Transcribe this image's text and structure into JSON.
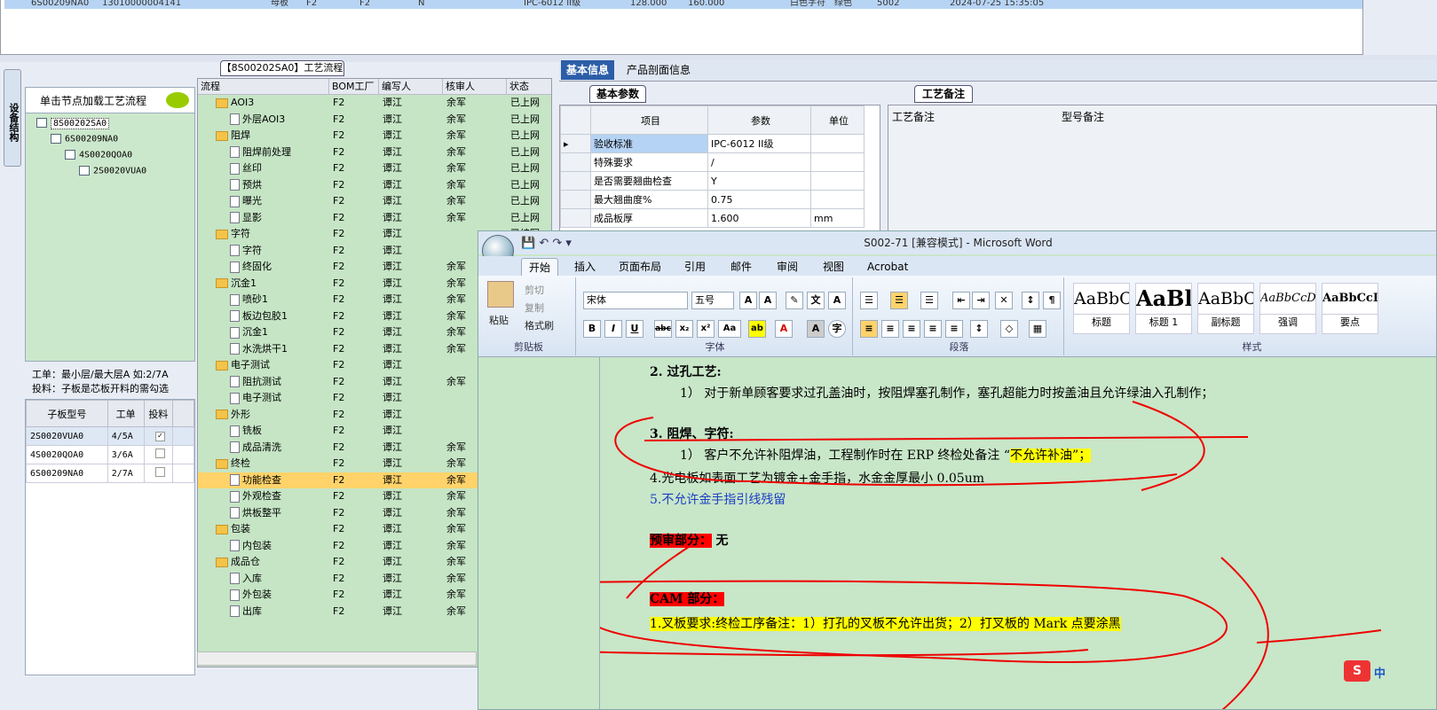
{
  "top_row": {
    "c1": "6S00209NA0",
    "c2": "13010000004141",
    "c3": "母板",
    "c4": "F2",
    "c5": "F2",
    "c6": "N",
    "c7": "IPC-6012 II级",
    "c8": "128.000",
    "c9": "160.000",
    "c10": "白色字符",
    "c11": "绿色",
    "c12": "5002",
    "c13": "2024-07-25 15:35:05"
  },
  "side_tab": "设备结构",
  "flow_title": "【8S00202SA0】工艺流程",
  "tree": {
    "hint": "单击节点加载工艺流程",
    "nodes": [
      "8S00202SA0",
      "6S00209NA0",
      "4S0020QOA0",
      "2S0020VUA0"
    ]
  },
  "order_info": {
    "line1": "工单：最小层/最大层A 如:2/7A",
    "line2": "投料：子板是芯板开料的需勾选"
  },
  "sub_grid": {
    "headers": [
      "子板型号",
      "工单",
      "投料"
    ],
    "rows": [
      {
        "model": "2S0020VUA0",
        "order": "4/5A",
        "checked": "✓"
      },
      {
        "model": "4S0020QOA0",
        "order": "3/6A",
        "checked": ""
      },
      {
        "model": "6S00209NA0",
        "order": "2/7A",
        "checked": ""
      }
    ]
  },
  "flow_grid": {
    "headers": [
      "流程",
      "BOM工厂",
      "编写人",
      "核审人",
      "状态"
    ],
    "rows": [
      {
        "name": "AOI3",
        "folder": true,
        "f": "F2",
        "w": "谭江",
        "r": "余军",
        "s": "已上网"
      },
      {
        "name": "外层AOI3",
        "folder": false,
        "f": "F2",
        "w": "谭江",
        "r": "余军",
        "s": "已上网"
      },
      {
        "name": "阻焊",
        "folder": true,
        "f": "F2",
        "w": "谭江",
        "r": "余军",
        "s": "已上网"
      },
      {
        "name": "阻焊前处理",
        "folder": false,
        "f": "F2",
        "w": "谭江",
        "r": "余军",
        "s": "已上网"
      },
      {
        "name": "丝印",
        "folder": false,
        "f": "F2",
        "w": "谭江",
        "r": "余军",
        "s": "已上网"
      },
      {
        "name": "预烘",
        "folder": false,
        "f": "F2",
        "w": "谭江",
        "r": "余军",
        "s": "已上网"
      },
      {
        "name": "曝光",
        "folder": false,
        "f": "F2",
        "w": "谭江",
        "r": "余军",
        "s": "已上网"
      },
      {
        "name": "显影",
        "folder": false,
        "f": "F2",
        "w": "谭江",
        "r": "余军",
        "s": "已上网"
      },
      {
        "name": "字符",
        "folder": true,
        "f": "F2",
        "w": "谭江",
        "r": "",
        "s": "已编写"
      },
      {
        "name": "字符",
        "folder": false,
        "f": "F2",
        "w": "谭江",
        "r": "",
        "s": ""
      },
      {
        "name": "终固化",
        "folder": false,
        "f": "F2",
        "w": "谭江",
        "r": "余军",
        "s": ""
      },
      {
        "name": "沉金1",
        "folder": true,
        "f": "F2",
        "w": "谭江",
        "r": "余军",
        "s": ""
      },
      {
        "name": "喷砂1",
        "folder": false,
        "f": "F2",
        "w": "谭江",
        "r": "余军",
        "s": ""
      },
      {
        "name": "板边包胶1",
        "folder": false,
        "f": "F2",
        "w": "谭江",
        "r": "余军",
        "s": ""
      },
      {
        "name": "沉金1",
        "folder": false,
        "f": "F2",
        "w": "谭江",
        "r": "余军",
        "s": ""
      },
      {
        "name": "水洗烘干1",
        "folder": false,
        "f": "F2",
        "w": "谭江",
        "r": "余军",
        "s": ""
      },
      {
        "name": "电子测试",
        "folder": true,
        "f": "F2",
        "w": "谭江",
        "r": "",
        "s": ""
      },
      {
        "name": "阻抗测试",
        "folder": false,
        "f": "F2",
        "w": "谭江",
        "r": "余军",
        "s": ""
      },
      {
        "name": "电子测试",
        "folder": false,
        "f": "F2",
        "w": "谭江",
        "r": "",
        "s": ""
      },
      {
        "name": "外形",
        "folder": true,
        "f": "F2",
        "w": "谭江",
        "r": "",
        "s": ""
      },
      {
        "name": "铣板",
        "folder": false,
        "f": "F2",
        "w": "谭江",
        "r": "",
        "s": ""
      },
      {
        "name": "成品清洗",
        "folder": false,
        "f": "F2",
        "w": "谭江",
        "r": "余军",
        "s": ""
      },
      {
        "name": "终检",
        "folder": true,
        "f": "F2",
        "w": "谭江",
        "r": "余军",
        "s": ""
      },
      {
        "name": "功能检查",
        "folder": false,
        "f": "F2",
        "w": "谭江",
        "r": "余军",
        "s": "",
        "hi": true
      },
      {
        "name": "外观检查",
        "folder": false,
        "f": "F2",
        "w": "谭江",
        "r": "余军",
        "s": ""
      },
      {
        "name": "烘板整平",
        "folder": false,
        "f": "F2",
        "w": "谭江",
        "r": "余军",
        "s": ""
      },
      {
        "name": "包装",
        "folder": true,
        "f": "F2",
        "w": "谭江",
        "r": "余军",
        "s": ""
      },
      {
        "name": "内包装",
        "folder": false,
        "f": "F2",
        "w": "谭江",
        "r": "余军",
        "s": ""
      },
      {
        "name": "成品仓",
        "folder": true,
        "f": "F2",
        "w": "谭江",
        "r": "余军",
        "s": ""
      },
      {
        "name": "入库",
        "folder": false,
        "f": "F2",
        "w": "谭江",
        "r": "余军",
        "s": ""
      },
      {
        "name": "外包装",
        "folder": false,
        "f": "F2",
        "w": "谭江",
        "r": "余军",
        "s": ""
      },
      {
        "name": "出库",
        "folder": false,
        "f": "F2",
        "w": "谭江",
        "r": "余军",
        "s": ""
      }
    ]
  },
  "info_tabs": [
    "基本信息",
    "产品剖面信息"
  ],
  "param_tab": "基本参数",
  "param_grid": {
    "headers": [
      "项目",
      "参数",
      "单位"
    ],
    "rows": [
      {
        "item": "验收标准",
        "value": "IPC-6012 II级",
        "unit": ""
      },
      {
        "item": "特殊要求",
        "value": "/",
        "unit": ""
      },
      {
        "item": "是否需要翘曲检查",
        "value": "Y",
        "unit": ""
      },
      {
        "item": "最大翘曲度%",
        "value": "0.75",
        "unit": ""
      },
      {
        "item": "成品板厚",
        "value": "1.600",
        "unit": "mm"
      }
    ]
  },
  "note_tab": "工艺备注",
  "note_headers": [
    "工艺备注",
    "型号备注"
  ],
  "word": {
    "title": "S002-71 [兼容模式] - Microsoft Word",
    "tabs": [
      "开始",
      "插入",
      "页面布局",
      "引用",
      "邮件",
      "审阅",
      "视图",
      "Acrobat"
    ],
    "clipboard": {
      "paste": "粘贴",
      "cut": "剪切",
      "copy": "复制",
      "painter": "格式刷",
      "label": "剪贴板"
    },
    "font": {
      "name": "宋体",
      "size": "五号",
      "label": "字体"
    },
    "para_label": "段落",
    "styles_label": "样式",
    "styles": [
      {
        "sample": "AaBbC",
        "name": "标题"
      },
      {
        "sample": "AaBl",
        "name": "标题 1"
      },
      {
        "sample": "AaBbC",
        "name": "副标题"
      },
      {
        "sample": "AaBbCcD",
        "name": "强调"
      },
      {
        "sample": "AaBbCcD",
        "name": "要点"
      }
    ],
    "lines": {
      "l1": "2.  过孔工艺:",
      "l2": "1） 对于新单顾客要求过孔盖油时，按阻焊塞孔制作，塞孔超能力时按盖油且允许绿油入孔制作；",
      "l3": "3.  阻焊、字符:",
      "l4a": "1） 客户不允许补阻焊油，工程制作时在 ERP 终检处备注 “",
      "l4b": "不允许补油”；",
      "l5": "4.光电板如表面工艺为镀金+金手指，水金金厚最小 0.05um",
      "l6": "5.不允许金手指引线残留",
      "l7a": "预审部分：",
      "l7b": "无",
      "l8": "CAM 部分：",
      "l9": "1.叉板要求:终检工序备注：1）打孔的叉板不允许出货；2）打叉板的 Mark 点要涂黑"
    }
  },
  "ime": {
    "logo": "S",
    "mode": "中"
  }
}
